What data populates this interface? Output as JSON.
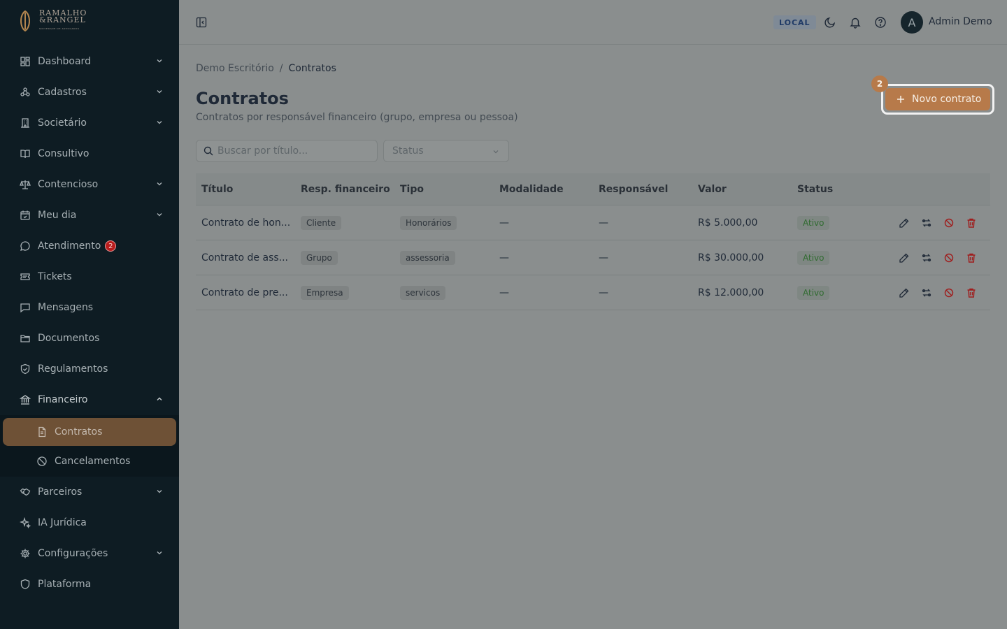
{
  "brand": {
    "line1": "RAMALHO",
    "line2": "&RANGEL",
    "line3": "SOCIEDADE DE ADVOGADOS"
  },
  "sidebar": {
    "items": [
      {
        "label": "Dashboard",
        "icon": "grid-icon",
        "chevron": true
      },
      {
        "label": "Cadastros",
        "icon": "network-icon",
        "chevron": true
      },
      {
        "label": "Societário",
        "icon": "building-icon",
        "chevron": true
      },
      {
        "label": "Consultivo",
        "icon": "book-icon",
        "chevron": false
      },
      {
        "label": "Contencioso",
        "icon": "scale-icon",
        "chevron": true
      },
      {
        "label": "Meu dia",
        "icon": "calendar-icon",
        "chevron": true
      },
      {
        "label": "Atendimento",
        "icon": "chat-icon",
        "chevron": false,
        "badge": "2"
      },
      {
        "label": "Tickets",
        "icon": "ticket-icon",
        "chevron": false
      },
      {
        "label": "Mensagens",
        "icon": "message-icon",
        "chevron": false
      },
      {
        "label": "Documentos",
        "icon": "folder-icon",
        "chevron": false
      },
      {
        "label": "Regulamentos",
        "icon": "shield-check-icon",
        "chevron": false
      },
      {
        "label": "Financeiro",
        "icon": "bank-icon",
        "chevron": true
      }
    ],
    "financeiro_sub": [
      {
        "label": "Contratos",
        "icon": "document-icon"
      },
      {
        "label": "Cancelamentos",
        "icon": "ban-icon"
      }
    ],
    "items_after": [
      {
        "label": "Parceiros",
        "icon": "handshake-icon",
        "chevron": true
      },
      {
        "label": "IA Jurídica",
        "icon": "sparkle-icon",
        "chevron": false
      },
      {
        "label": "Configurações",
        "icon": "gear-icon",
        "chevron": true
      },
      {
        "label": "Plataforma",
        "icon": "shield-icon",
        "chevron": false
      }
    ]
  },
  "header": {
    "env": "LOCAL",
    "avatar_initial": "A",
    "user_name": "Admin Demo"
  },
  "breadcrumb": {
    "root": "Demo Escritório",
    "sep": "/",
    "current": "Contratos"
  },
  "page": {
    "title": "Contratos",
    "subtitle": "Contratos por responsável financeiro (grupo, empresa ou pessoa)",
    "new_button": "Novo contrato",
    "step_badge": "2"
  },
  "filters": {
    "search_placeholder": "Buscar por título...",
    "status_placeholder": "Status"
  },
  "table": {
    "columns": [
      "Título",
      "Resp. financeiro",
      "Tipo",
      "Modalidade",
      "Responsável",
      "Valor",
      "Status"
    ],
    "rows": [
      {
        "titulo": "Contrato de hon...",
        "resp": "Cliente",
        "tipo": "Honorários",
        "modalidade": "—",
        "responsavel": "—",
        "valor": "R$ 5.000,00",
        "status": "Ativo"
      },
      {
        "titulo": "Contrato de ass...",
        "resp": "Grupo",
        "tipo": "assessoria",
        "modalidade": "—",
        "responsavel": "—",
        "valor": "R$ 30.000,00",
        "status": "Ativo"
      },
      {
        "titulo": "Contrato de pre...",
        "resp": "Empresa",
        "tipo": "servicos",
        "modalidade": "—",
        "responsavel": "—",
        "valor": "R$ 12.000,00",
        "status": "Ativo"
      }
    ]
  },
  "colors": {
    "sidebar_bg": "#0e1c23",
    "accent": "#b77a4a",
    "active_item": "#6e5136",
    "danger": "#b91c1c"
  }
}
